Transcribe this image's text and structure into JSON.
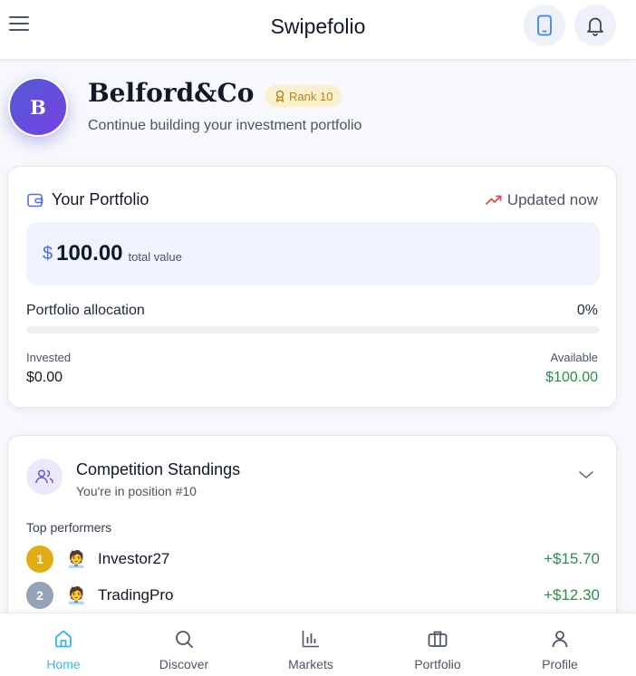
{
  "app": {
    "title": "Swipefolio"
  },
  "user": {
    "initial": "B",
    "name": "Belford&Co",
    "rank_label": "Rank 10",
    "subtitle": "Continue building your investment portfolio"
  },
  "portfolio": {
    "title": "Your Portfolio",
    "updated": "Updated now",
    "currency_symbol": "$",
    "total_value": "100.00",
    "total_value_label": "total value",
    "allocation_label": "Portfolio allocation",
    "allocation_pct": "0%",
    "allocation_fraction": 0,
    "invested_label": "Invested",
    "invested_value": "$0.00",
    "available_label": "Available",
    "available_value": "$100.00"
  },
  "competition": {
    "title": "Competition Standings",
    "subtitle": "You're in position #10",
    "top_label": "Top performers",
    "performers": [
      {
        "rank": "1",
        "emoji": "🧑‍💼",
        "name": "Investor27",
        "gain": "+$15.70",
        "rank_color": "#e0ac14"
      },
      {
        "rank": "2",
        "emoji": "🧑‍💼",
        "name": "TradingPro",
        "gain": "+$12.30",
        "rank_color": "#94a3b8"
      }
    ]
  },
  "nav": {
    "items": [
      {
        "label": "Home",
        "icon": "home-icon",
        "active": true
      },
      {
        "label": "Discover",
        "icon": "search-icon",
        "active": false
      },
      {
        "label": "Markets",
        "icon": "bar-chart-icon",
        "active": false
      },
      {
        "label": "Portfolio",
        "icon": "briefcase-icon",
        "active": false
      },
      {
        "label": "Profile",
        "icon": "user-icon",
        "active": false
      }
    ]
  },
  "colors": {
    "accent": "#4f6ee0",
    "gain": "#2f8a4f",
    "active_nav": "#38b6e8",
    "avatar_gradient_start": "#4f5bd5",
    "avatar_gradient_end": "#7b3fe4"
  }
}
